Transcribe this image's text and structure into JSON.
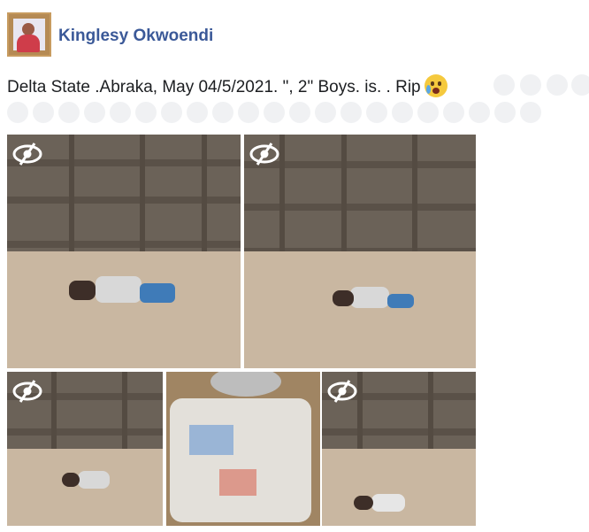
{
  "post": {
    "author": "Kinglesy Okwoendi",
    "text": "Delta State .Abraka, May 04/5/2021. \", 2\" Boys. is. . Rip",
    "emoji_icon": "crying-face-icon",
    "ghost_icon": "placeholder-emoji-icon"
  },
  "photos": {
    "count": 5,
    "sensitive_icon": "eye-slash-icon"
  },
  "colors": {
    "author": "#3b5998",
    "text": "#1c1e21",
    "placeholder_emoji": "#f0f1f3"
  }
}
